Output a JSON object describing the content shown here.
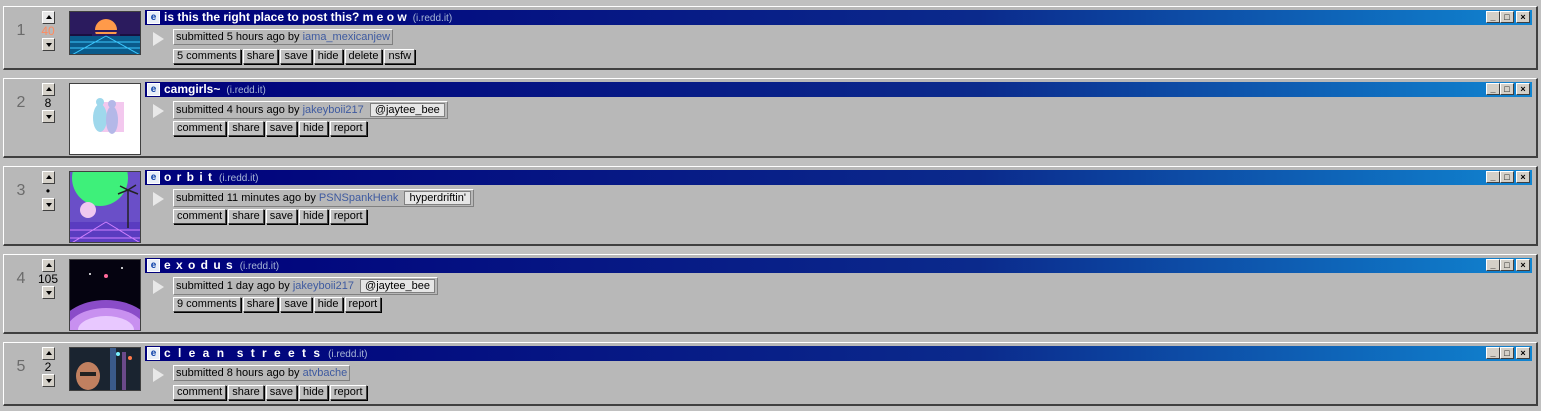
{
  "posts": [
    {
      "rank": "1",
      "score": "40",
      "title": "is this the right place to post this? m e o w",
      "domain": "(i.redd.it)",
      "submitted_prefix": "submitted 5 hours ago by",
      "author": "iama_mexicanjew",
      "flair": "",
      "buttons": [
        "5 comments",
        "share",
        "save",
        "hide",
        "delete",
        "nsfw"
      ]
    },
    {
      "rank": "2",
      "score": "8",
      "title": "camgirls~",
      "domain": "(i.redd.it)",
      "submitted_prefix": "submitted 4 hours ago by",
      "author": "jakeyboii217",
      "flair": "@jaytee_bee",
      "buttons": [
        "comment",
        "share",
        "save",
        "hide",
        "report"
      ]
    },
    {
      "rank": "3",
      "score": "•",
      "title": "o r b i t",
      "domain": "(i.redd.it)",
      "submitted_prefix": "submitted 11 minutes ago by",
      "author": "PSNSpankHenk",
      "flair": "hyperdriftin'",
      "buttons": [
        "comment",
        "share",
        "save",
        "hide",
        "report"
      ]
    },
    {
      "rank": "4",
      "score": "105",
      "title": "e x o d u s",
      "domain": "(i.redd.it)",
      "submitted_prefix": "submitted 1 day ago by",
      "author": "jakeyboii217",
      "flair": "@jaytee_bee",
      "buttons": [
        "9 comments",
        "share",
        "save",
        "hide",
        "report"
      ]
    },
    {
      "rank": "5",
      "score": "2",
      "title": "c l e a n  s t r e e t s",
      "domain": "(i.redd.it)",
      "submitted_prefix": "submitted 8 hours ago by",
      "author": "atvbache",
      "flair": "",
      "buttons": [
        "comment",
        "share",
        "save",
        "hide",
        "report"
      ]
    }
  ],
  "window_controls": {
    "minimize": "_",
    "maximize": "□",
    "close": "×"
  },
  "colors": {
    "titlebar_start": "#00007b",
    "titlebar_end": "#1084d0",
    "score_hot": "#ff8b60",
    "author": "#3e5aa0"
  },
  "icons": {
    "title_icon": "ie-icon",
    "thumb_play": "play-icon"
  }
}
